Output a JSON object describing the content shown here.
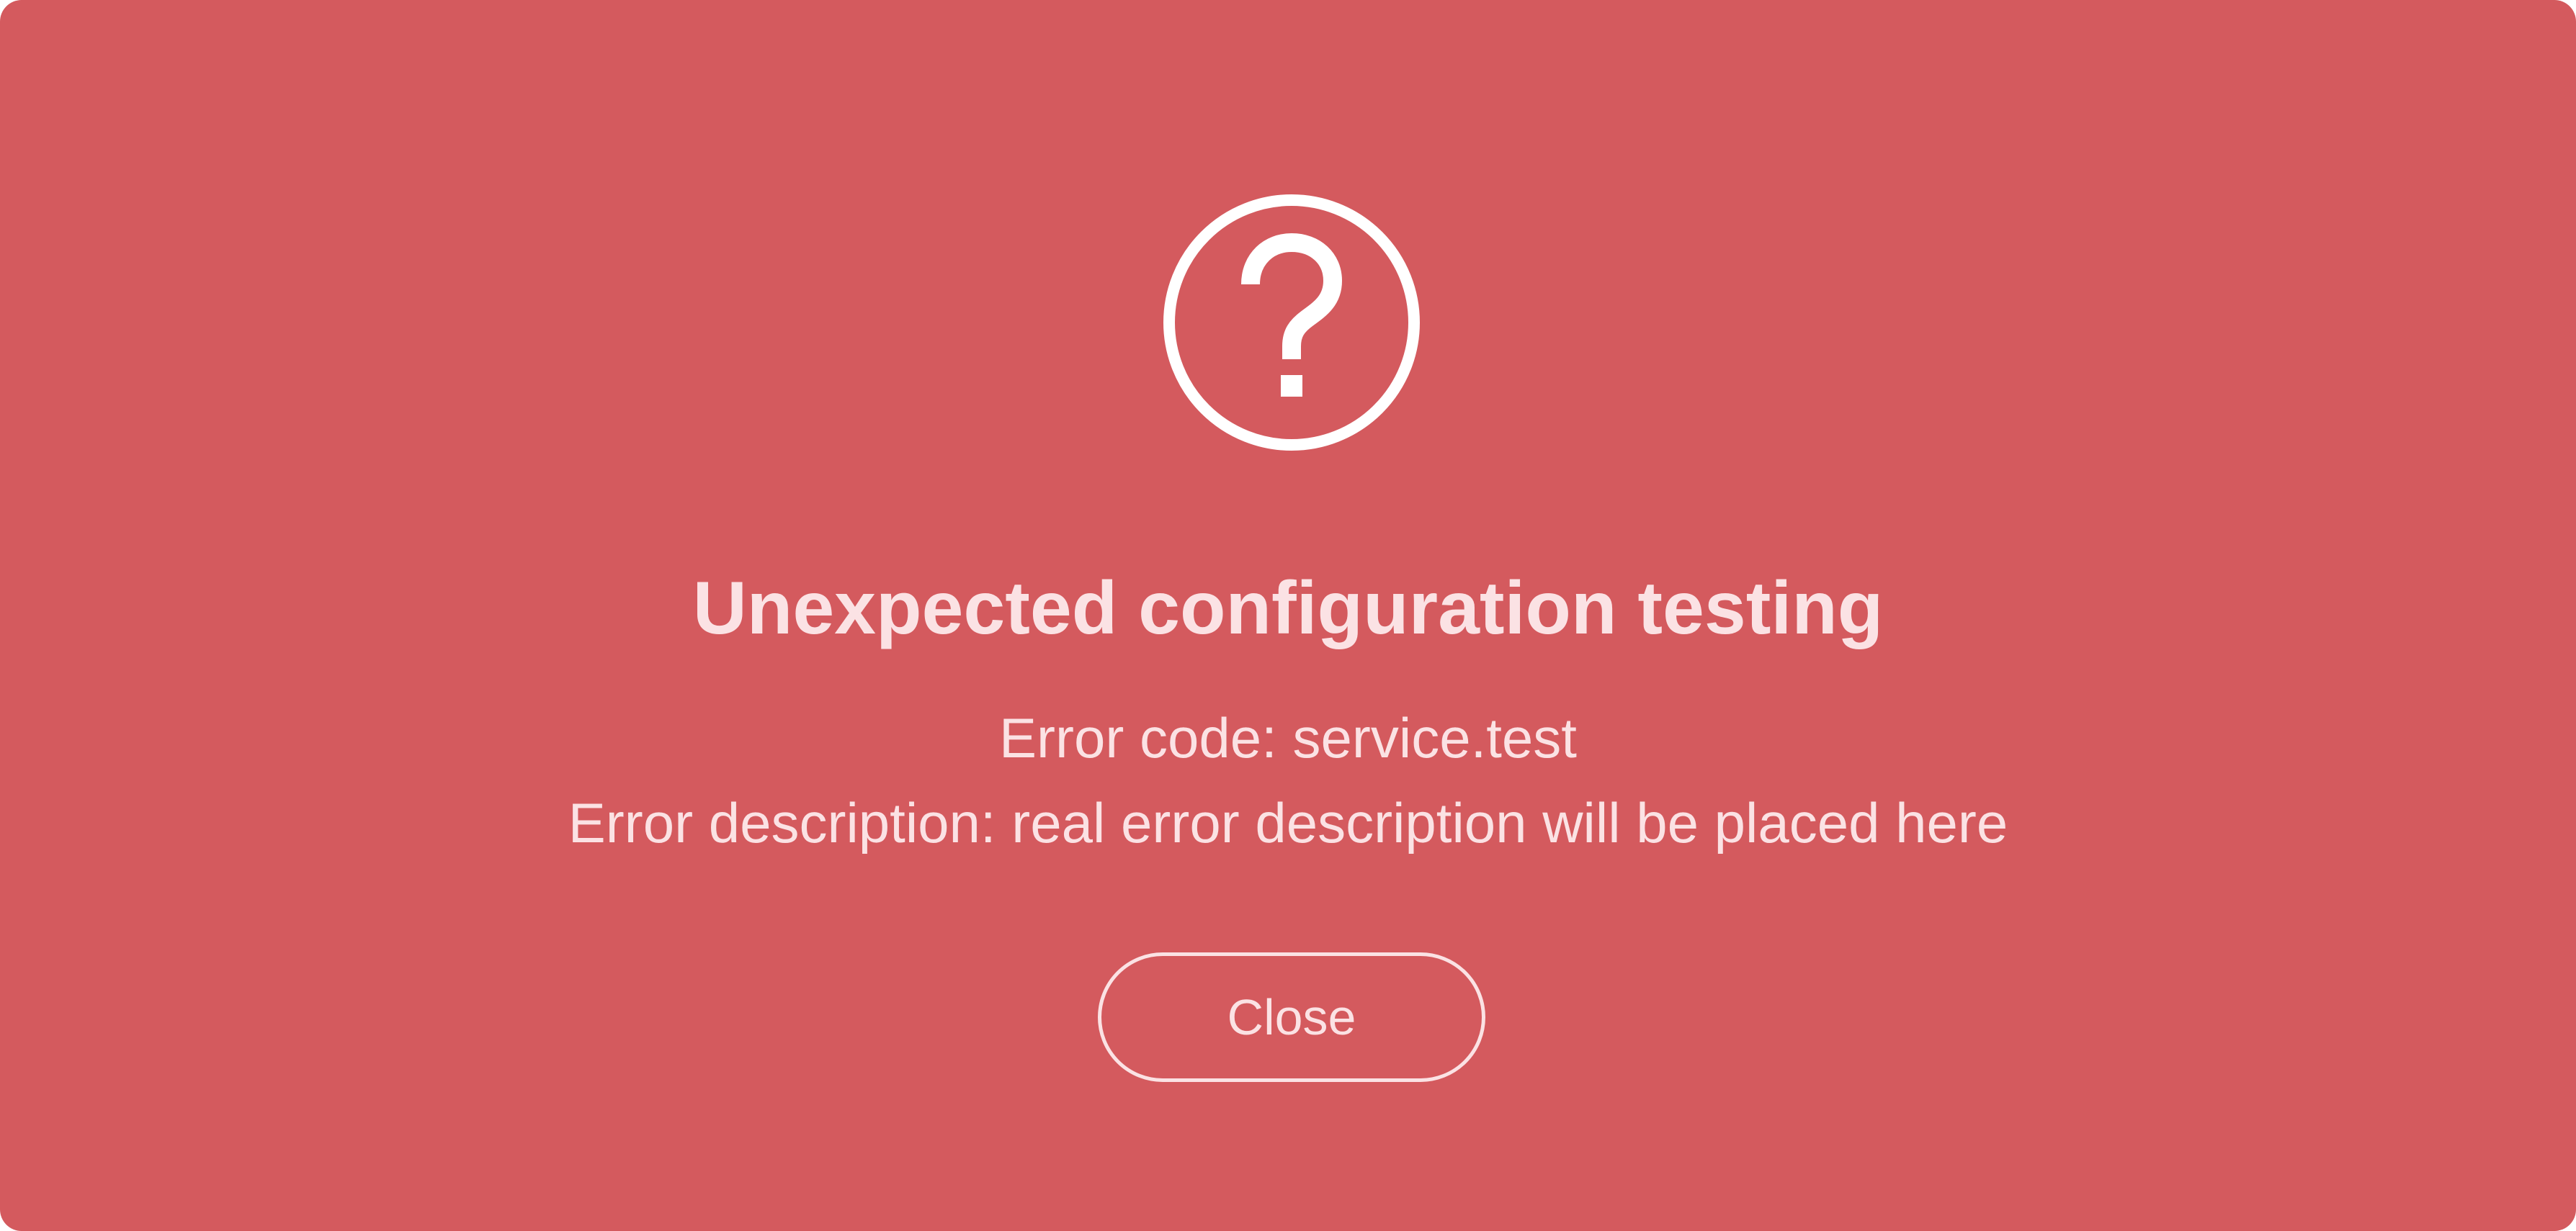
{
  "dialog": {
    "icon": "question-circle-icon",
    "title": "Unexpected configuration testing",
    "error_code_line": "Error code: service.test",
    "error_description_line": "Error description: real error description will be placed here",
    "close_label": "Close"
  },
  "colors": {
    "background": "#d45a5e",
    "foreground": "#fbe2e4",
    "icon": "#ffffff"
  }
}
